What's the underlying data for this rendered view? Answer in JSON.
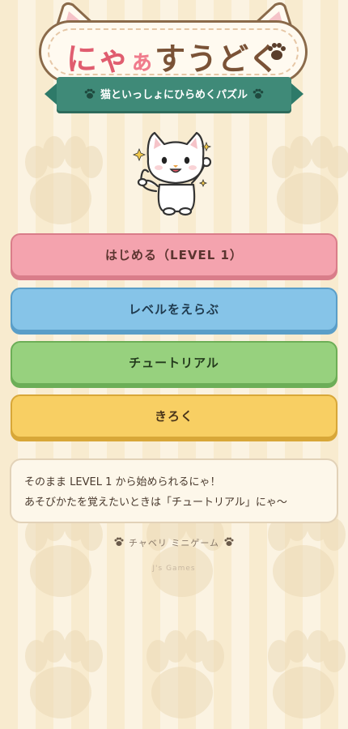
{
  "header": {
    "title_part1": "にゃ",
    "title_part2": "ぁ",
    "title_part3": "すうどく",
    "subtitle": "猫といっしょにひらめくパズル"
  },
  "menu": {
    "start_label": "はじめる（LEVEL 1）",
    "level_label": "レベルをえらぶ",
    "tutorial_label": "チュートリアル",
    "record_label": "きろく"
  },
  "message": {
    "line1": "そのまま LEVEL 1 から始められるにゃ！",
    "line2": "あそびかたを覚えたいときは「チュートリアル」にゃ〜"
  },
  "footer": {
    "series": "チャベリ ミニゲーム",
    "credit": "J's Games"
  },
  "colors": {
    "start": "#f4a3ae",
    "level": "#86c4e8",
    "tutorial": "#97d17e",
    "record": "#f8cf63",
    "ribbon": "#3f8a78"
  }
}
